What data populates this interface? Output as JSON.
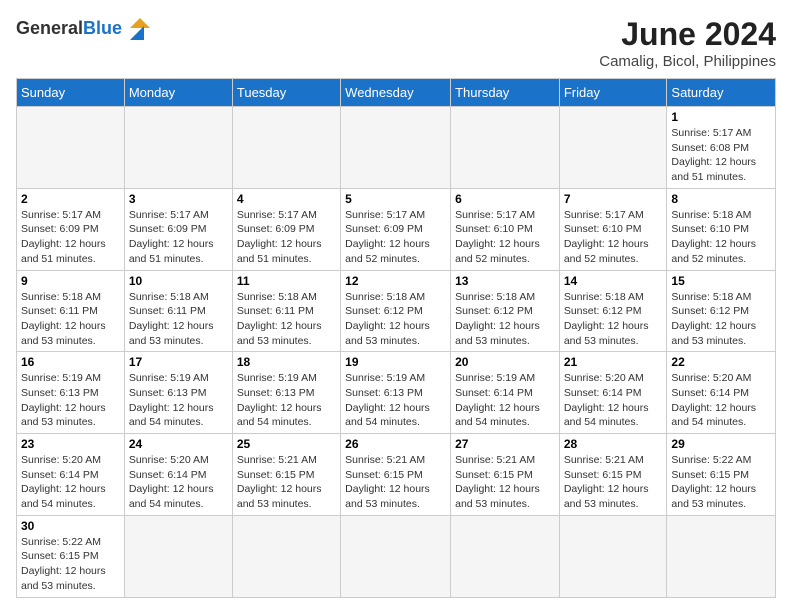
{
  "logo": {
    "text_general": "General",
    "text_blue": "Blue"
  },
  "title": "June 2024",
  "subtitle": "Camalig, Bicol, Philippines",
  "days_of_week": [
    "Sunday",
    "Monday",
    "Tuesday",
    "Wednesday",
    "Thursday",
    "Friday",
    "Saturday"
  ],
  "weeks": [
    [
      {
        "day": "",
        "info": "",
        "empty": true
      },
      {
        "day": "",
        "info": "",
        "empty": true
      },
      {
        "day": "",
        "info": "",
        "empty": true
      },
      {
        "day": "",
        "info": "",
        "empty": true
      },
      {
        "day": "",
        "info": "",
        "empty": true
      },
      {
        "day": "",
        "info": "",
        "empty": true
      },
      {
        "day": "1",
        "info": "Sunrise: 5:17 AM\nSunset: 6:08 PM\nDaylight: 12 hours and 51 minutes."
      }
    ],
    [
      {
        "day": "2",
        "info": "Sunrise: 5:17 AM\nSunset: 6:09 PM\nDaylight: 12 hours and 51 minutes."
      },
      {
        "day": "3",
        "info": "Sunrise: 5:17 AM\nSunset: 6:09 PM\nDaylight: 12 hours and 51 minutes."
      },
      {
        "day": "4",
        "info": "Sunrise: 5:17 AM\nSunset: 6:09 PM\nDaylight: 12 hours and 51 minutes."
      },
      {
        "day": "5",
        "info": "Sunrise: 5:17 AM\nSunset: 6:09 PM\nDaylight: 12 hours and 52 minutes."
      },
      {
        "day": "6",
        "info": "Sunrise: 5:17 AM\nSunset: 6:10 PM\nDaylight: 12 hours and 52 minutes."
      },
      {
        "day": "7",
        "info": "Sunrise: 5:17 AM\nSunset: 6:10 PM\nDaylight: 12 hours and 52 minutes."
      },
      {
        "day": "8",
        "info": "Sunrise: 5:18 AM\nSunset: 6:10 PM\nDaylight: 12 hours and 52 minutes."
      }
    ],
    [
      {
        "day": "9",
        "info": "Sunrise: 5:18 AM\nSunset: 6:11 PM\nDaylight: 12 hours and 53 minutes."
      },
      {
        "day": "10",
        "info": "Sunrise: 5:18 AM\nSunset: 6:11 PM\nDaylight: 12 hours and 53 minutes."
      },
      {
        "day": "11",
        "info": "Sunrise: 5:18 AM\nSunset: 6:11 PM\nDaylight: 12 hours and 53 minutes."
      },
      {
        "day": "12",
        "info": "Sunrise: 5:18 AM\nSunset: 6:12 PM\nDaylight: 12 hours and 53 minutes."
      },
      {
        "day": "13",
        "info": "Sunrise: 5:18 AM\nSunset: 6:12 PM\nDaylight: 12 hours and 53 minutes."
      },
      {
        "day": "14",
        "info": "Sunrise: 5:18 AM\nSunset: 6:12 PM\nDaylight: 12 hours and 53 minutes."
      },
      {
        "day": "15",
        "info": "Sunrise: 5:18 AM\nSunset: 6:12 PM\nDaylight: 12 hours and 53 minutes."
      }
    ],
    [
      {
        "day": "16",
        "info": "Sunrise: 5:19 AM\nSunset: 6:13 PM\nDaylight: 12 hours and 53 minutes."
      },
      {
        "day": "17",
        "info": "Sunrise: 5:19 AM\nSunset: 6:13 PM\nDaylight: 12 hours and 54 minutes."
      },
      {
        "day": "18",
        "info": "Sunrise: 5:19 AM\nSunset: 6:13 PM\nDaylight: 12 hours and 54 minutes."
      },
      {
        "day": "19",
        "info": "Sunrise: 5:19 AM\nSunset: 6:13 PM\nDaylight: 12 hours and 54 minutes."
      },
      {
        "day": "20",
        "info": "Sunrise: 5:19 AM\nSunset: 6:14 PM\nDaylight: 12 hours and 54 minutes."
      },
      {
        "day": "21",
        "info": "Sunrise: 5:20 AM\nSunset: 6:14 PM\nDaylight: 12 hours and 54 minutes."
      },
      {
        "day": "22",
        "info": "Sunrise: 5:20 AM\nSunset: 6:14 PM\nDaylight: 12 hours and 54 minutes."
      }
    ],
    [
      {
        "day": "23",
        "info": "Sunrise: 5:20 AM\nSunset: 6:14 PM\nDaylight: 12 hours and 54 minutes."
      },
      {
        "day": "24",
        "info": "Sunrise: 5:20 AM\nSunset: 6:14 PM\nDaylight: 12 hours and 54 minutes."
      },
      {
        "day": "25",
        "info": "Sunrise: 5:21 AM\nSunset: 6:15 PM\nDaylight: 12 hours and 53 minutes."
      },
      {
        "day": "26",
        "info": "Sunrise: 5:21 AM\nSunset: 6:15 PM\nDaylight: 12 hours and 53 minutes."
      },
      {
        "day": "27",
        "info": "Sunrise: 5:21 AM\nSunset: 6:15 PM\nDaylight: 12 hours and 53 minutes."
      },
      {
        "day": "28",
        "info": "Sunrise: 5:21 AM\nSunset: 6:15 PM\nDaylight: 12 hours and 53 minutes."
      },
      {
        "day": "29",
        "info": "Sunrise: 5:22 AM\nSunset: 6:15 PM\nDaylight: 12 hours and 53 minutes."
      }
    ],
    [
      {
        "day": "30",
        "info": "Sunrise: 5:22 AM\nSunset: 6:15 PM\nDaylight: 12 hours and 53 minutes."
      },
      {
        "day": "",
        "info": "",
        "empty": true
      },
      {
        "day": "",
        "info": "",
        "empty": true
      },
      {
        "day": "",
        "info": "",
        "empty": true
      },
      {
        "day": "",
        "info": "",
        "empty": true
      },
      {
        "day": "",
        "info": "",
        "empty": true
      },
      {
        "day": "",
        "info": "",
        "empty": true
      }
    ]
  ]
}
